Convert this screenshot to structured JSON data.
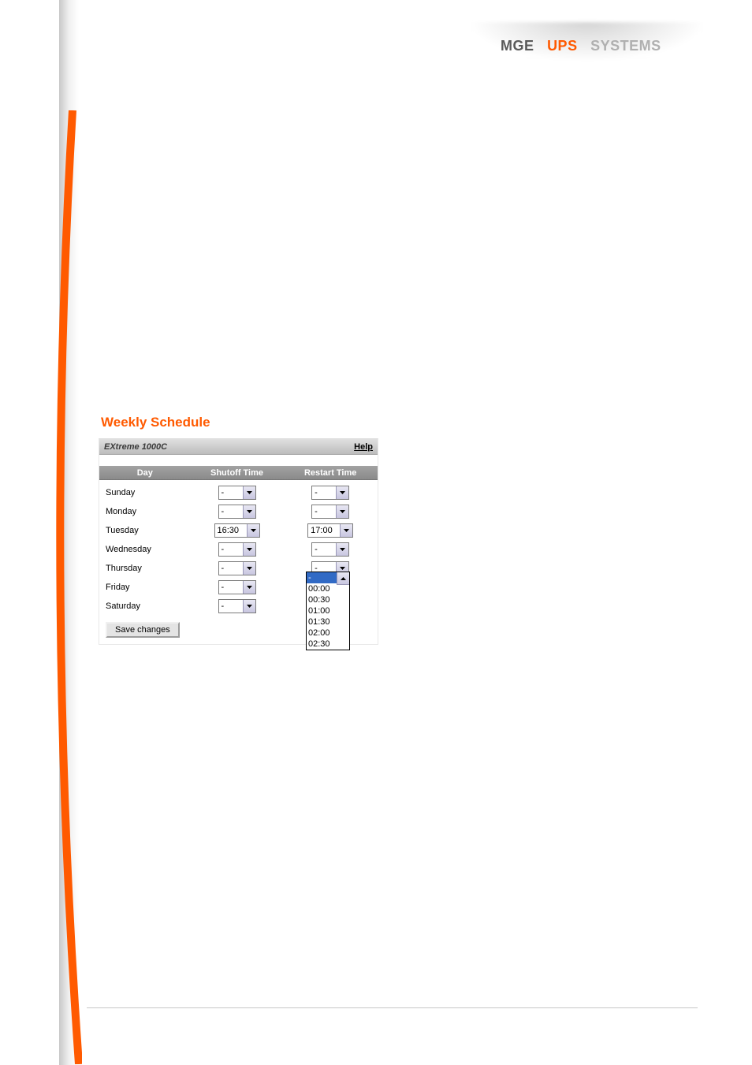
{
  "brand": {
    "w1": "MGE",
    "w2": "UPS",
    "w3": "SYSTEMS"
  },
  "title": "Weekly Schedule",
  "device": "EXtreme 1000C",
  "help_label": "Help",
  "columns": {
    "day": "Day",
    "shutoff": "Shutoff Time",
    "restart": "Restart Time"
  },
  "days": [
    {
      "name": "Sunday",
      "shutoff": "-",
      "restart": "-"
    },
    {
      "name": "Monday",
      "shutoff": "-",
      "restart": "-"
    },
    {
      "name": "Tuesday",
      "shutoff": "16:30",
      "restart": "17:00"
    },
    {
      "name": "Wednesday",
      "shutoff": "-",
      "restart": "-"
    },
    {
      "name": "Thursday",
      "shutoff": "-",
      "restart": "-"
    },
    {
      "name": "Friday",
      "shutoff": "-",
      "restart": "-"
    },
    {
      "name": "Saturday",
      "shutoff": "-",
      "restart": ""
    }
  ],
  "dropdown_options": [
    "-",
    "00:00",
    "00:30",
    "01:00",
    "01:30",
    "02:00",
    "02:30"
  ],
  "dropdown_selected": "-",
  "save_label": "Save changes"
}
